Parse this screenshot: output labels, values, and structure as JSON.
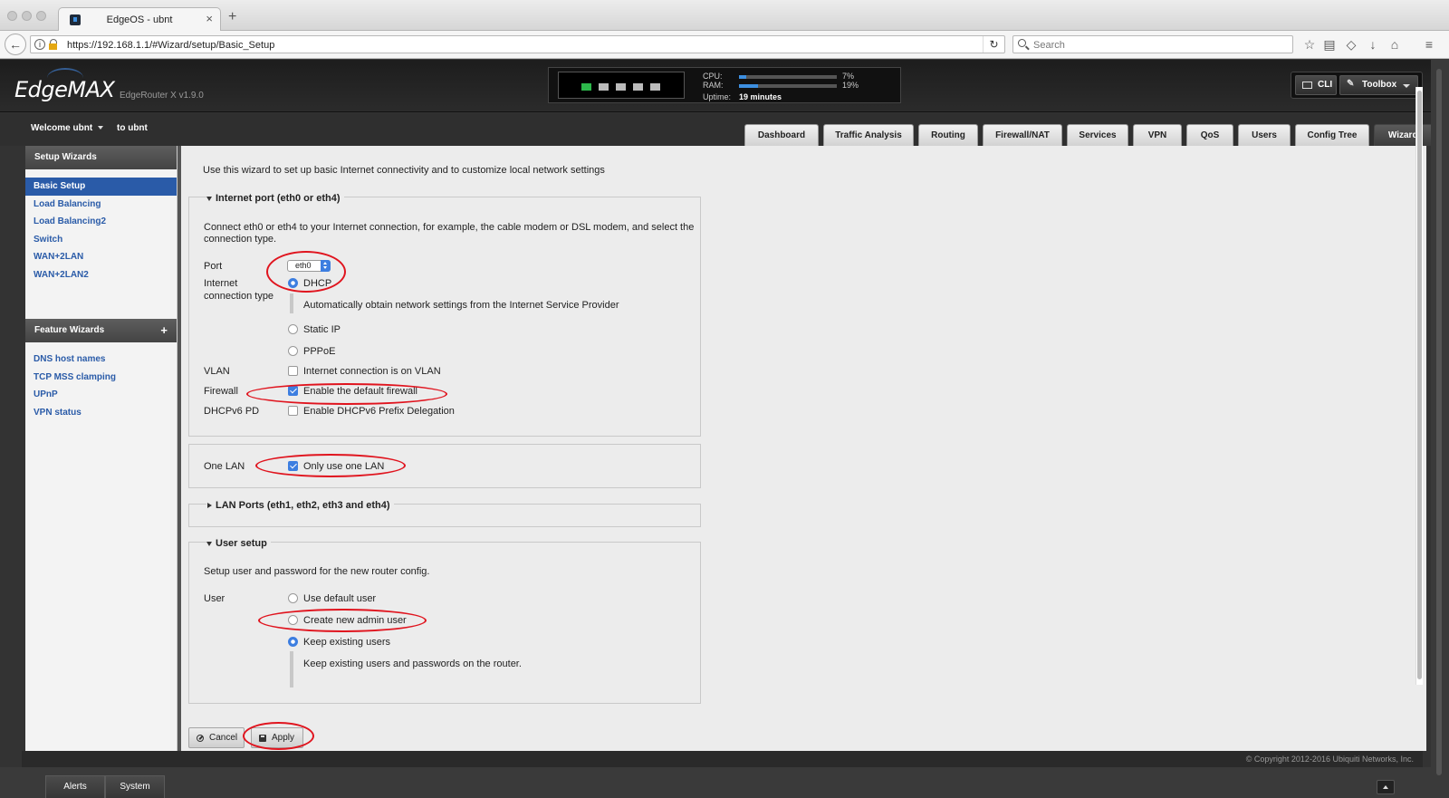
{
  "browser": {
    "tab_title": "EdgeOS - ubnt",
    "url": "https://192.168.1.1/#Wizard/setup/Basic_Setup",
    "search_placeholder": "Search"
  },
  "header": {
    "logo": "EdgeMAX",
    "version": "EdgeRouter X v1.9.0",
    "cpu_label": "CPU:",
    "cpu_value": "7%",
    "cpu_fraction": 0.07,
    "ram_label": "RAM:",
    "ram_value": "19%",
    "ram_fraction": 0.19,
    "uptime_label": "Uptime:",
    "uptime_value": "19 minutes",
    "cli_label": "CLI",
    "toolbox_label": "Toolbox"
  },
  "subnav": {
    "welcome": "Welcome ubnt",
    "to_ubnt": "to ubnt",
    "tabs": [
      "Dashboard",
      "Traffic Analysis",
      "Routing",
      "Firewall/NAT",
      "Services",
      "VPN",
      "QoS",
      "Users",
      "Config Tree",
      "Wizards"
    ],
    "active_tab": "Wizards"
  },
  "sidebar": {
    "setup_title": "Setup Wizards",
    "setup_items": [
      "Basic Setup",
      "Load Balancing",
      "Load Balancing2",
      "Switch",
      "WAN+2LAN",
      "WAN+2LAN2"
    ],
    "feature_title": "Feature Wizards",
    "feature_items": [
      "DNS host names",
      "TCP MSS clamping",
      "UPnP",
      "VPN status"
    ]
  },
  "wizard": {
    "intro": "Use this wizard to set up basic Internet connectivity and to customize local network settings",
    "internet": {
      "legend": "Internet port (eth0 or eth4)",
      "desc_line1": "Connect eth0 or eth4 to your Internet connection, for example, the cable modem or DSL modem, and select the",
      "desc_line2": "connection type.",
      "port_label": "Port",
      "port_value": "eth0",
      "conn_label_1": "Internet",
      "conn_label_2": "connection type",
      "dhcp": "DHCP",
      "dhcp_desc": "Automatically obtain network settings from the Internet Service Provider",
      "static": "Static IP",
      "pppoe": "PPPoE",
      "vlan_label": "VLAN",
      "vlan_opt": "Internet connection is on VLAN",
      "firewall_label": "Firewall",
      "firewall_opt": "Enable the default firewall",
      "dhcpv6_label": "DHCPv6 PD",
      "dhcpv6_opt": "Enable DHCPv6 Prefix Delegation"
    },
    "onelan": {
      "label": "One LAN",
      "opt": "Only use one LAN"
    },
    "lanports": {
      "legend": "LAN Ports (eth1, eth2, eth3 and eth4)"
    },
    "user": {
      "legend": "User setup",
      "desc": "Setup user and password for the new router config.",
      "label": "User",
      "opt_default": "Use default user",
      "opt_new": "Create new admin user",
      "opt_keep": "Keep existing users",
      "keep_desc": "Keep existing users and passwords on the router."
    },
    "cancel": "Cancel",
    "apply": "Apply"
  },
  "footer": {
    "copyright": "© Copyright 2012-2016 Ubiquiti Networks, Inc.",
    "tabs": [
      "Alerts",
      "System"
    ]
  }
}
